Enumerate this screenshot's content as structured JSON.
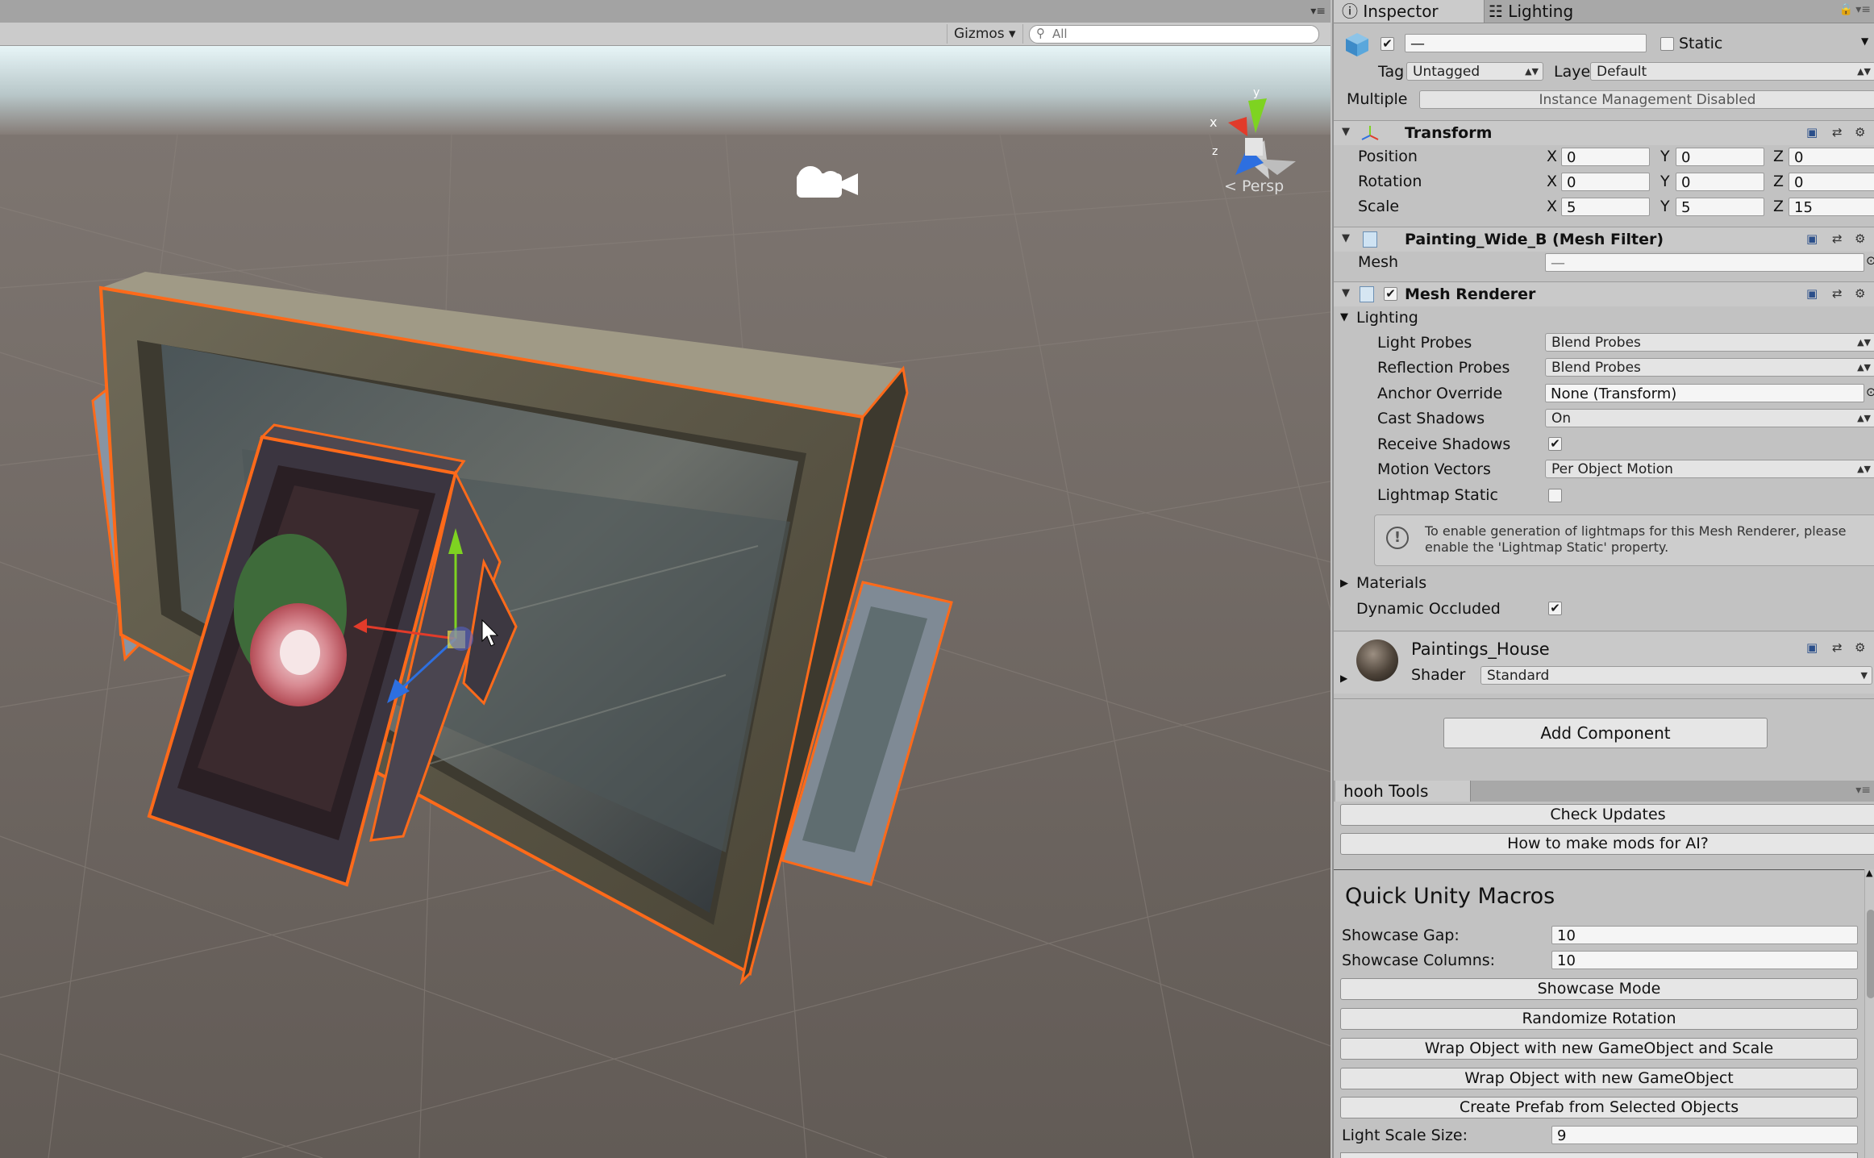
{
  "scene": {
    "gizmos_label": "Gizmos",
    "search_placeholder": "All",
    "projection_label": "< Persp",
    "axis_labels": {
      "x": "x",
      "y": "y",
      "z": "z"
    }
  },
  "inspector": {
    "tabs": [
      "Inspector",
      "Lighting"
    ],
    "object": {
      "name": "—",
      "active": true,
      "static_label": "Static",
      "static_checked": false,
      "tag_label": "Tag",
      "tag_value": "Untagged",
      "layer_label": "Layer",
      "layer_value": "Default",
      "multiple_label": "Multiple",
      "instance_management": "Instance Management Disabled"
    },
    "transform": {
      "title": "Transform",
      "rows": [
        {
          "label": "Position",
          "x": "0",
          "y": "0",
          "z": "0"
        },
        {
          "label": "Rotation",
          "x": "0",
          "y": "0",
          "z": "0"
        },
        {
          "label": "Scale",
          "x": "5",
          "y": "5",
          "z": "15"
        }
      ]
    },
    "mesh_filter": {
      "title": "Painting_Wide_B (Mesh Filter)",
      "mesh_label": "Mesh",
      "mesh_value": "—"
    },
    "mesh_renderer": {
      "title": "Mesh Renderer",
      "enabled": true,
      "lighting_label": "Lighting",
      "light_probes_label": "Light Probes",
      "light_probes_value": "Blend Probes",
      "reflection_probes_label": "Reflection Probes",
      "reflection_probes_value": "Blend Probes",
      "anchor_override_label": "Anchor Override",
      "anchor_override_value": "None (Transform)",
      "cast_shadows_label": "Cast Shadows",
      "cast_shadows_value": "On",
      "receive_shadows_label": "Receive Shadows",
      "receive_shadows": true,
      "motion_vectors_label": "Motion Vectors",
      "motion_vectors_value": "Per Object Motion",
      "lightmap_static_label": "Lightmap Static",
      "lightmap_static": false,
      "info_line1": "To enable generation of lightmaps for this Mesh Renderer, please",
      "info_line2": "enable the 'Lightmap Static' property.",
      "materials_label": "Materials",
      "dynamic_occluded_label": "Dynamic Occluded",
      "dynamic_occluded": true
    },
    "material": {
      "name": "Paintings_House",
      "shader_label": "Shader",
      "shader_value": "Standard"
    },
    "add_component_label": "Add Component"
  },
  "hooh_tools": {
    "tab_label": "hooh Tools",
    "check_updates": "Check Updates",
    "how_to_mods": "How to make mods for AI?",
    "section_title": "Quick Unity Macros",
    "showcase_gap_label": "Showcase Gap:",
    "showcase_gap_value": "10",
    "showcase_columns_label": "Showcase Columns:",
    "showcase_columns_value": "10",
    "buttons": [
      "Showcase Mode",
      "Randomize Rotation",
      "Wrap Object with new GameObject and Scale",
      "Wrap Object with new GameObject",
      "Create Prefab from Selected Objects"
    ],
    "light_scale_label": "Light Scale Size:",
    "light_scale_value": "9"
  },
  "colors": {
    "selection_outline": "#ff6a1a",
    "gizmo_x": "#e23b2a",
    "gizmo_y": "#7ed321",
    "gizmo_z": "#2d6fe0",
    "checkbox_check": "#1a1a1a"
  }
}
